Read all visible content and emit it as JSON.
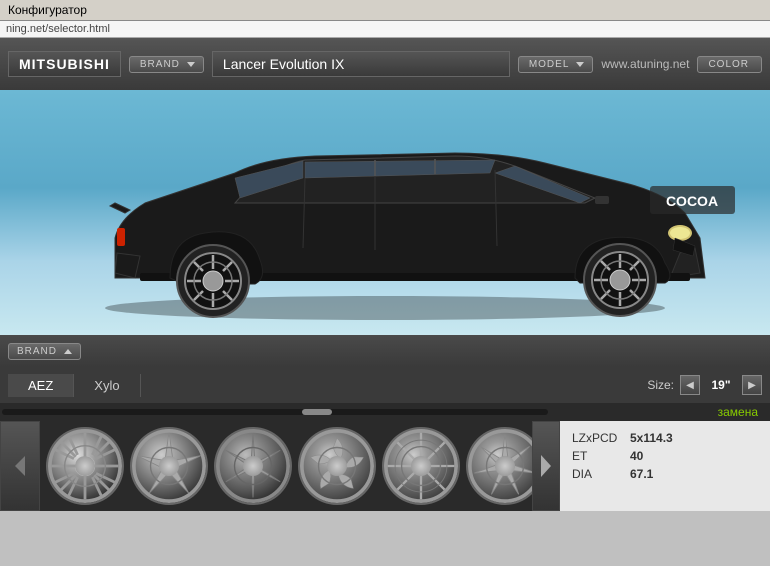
{
  "titlebar": {
    "title": "Конфигуратор"
  },
  "urlbar": {
    "url": "ning.net/selector.html"
  },
  "header": {
    "brand_name": "MITSUBISHI",
    "model_name": "Lancer Evolution IX",
    "brand_btn": "BRAND",
    "model_btn": "MODEL",
    "color_btn": "COLOR",
    "website": "www.atuning.net"
  },
  "wheel_section": {
    "brand_sort_label": "BRAND",
    "brands": [
      {
        "label": "AEZ",
        "active": true
      },
      {
        "label": "Xylo",
        "active": false
      }
    ],
    "size_label": "Size:",
    "size_value": "19\"",
    "zamena": "замена",
    "specs": {
      "lzxpcd_key": "LZxPCD",
      "lzxpcd_val": "5x114.3",
      "et_key": "ET",
      "et_val": "40",
      "dia_key": "DIA",
      "dia_val": "67.1"
    },
    "wheels": [
      {
        "id": 1,
        "style": "multi-spoke"
      },
      {
        "id": 2,
        "style": "5-spoke"
      },
      {
        "id": 3,
        "style": "star-spoke"
      },
      {
        "id": 4,
        "style": "5-blade"
      },
      {
        "id": 5,
        "style": "mesh"
      },
      {
        "id": 6,
        "style": "7-spoke"
      }
    ]
  }
}
